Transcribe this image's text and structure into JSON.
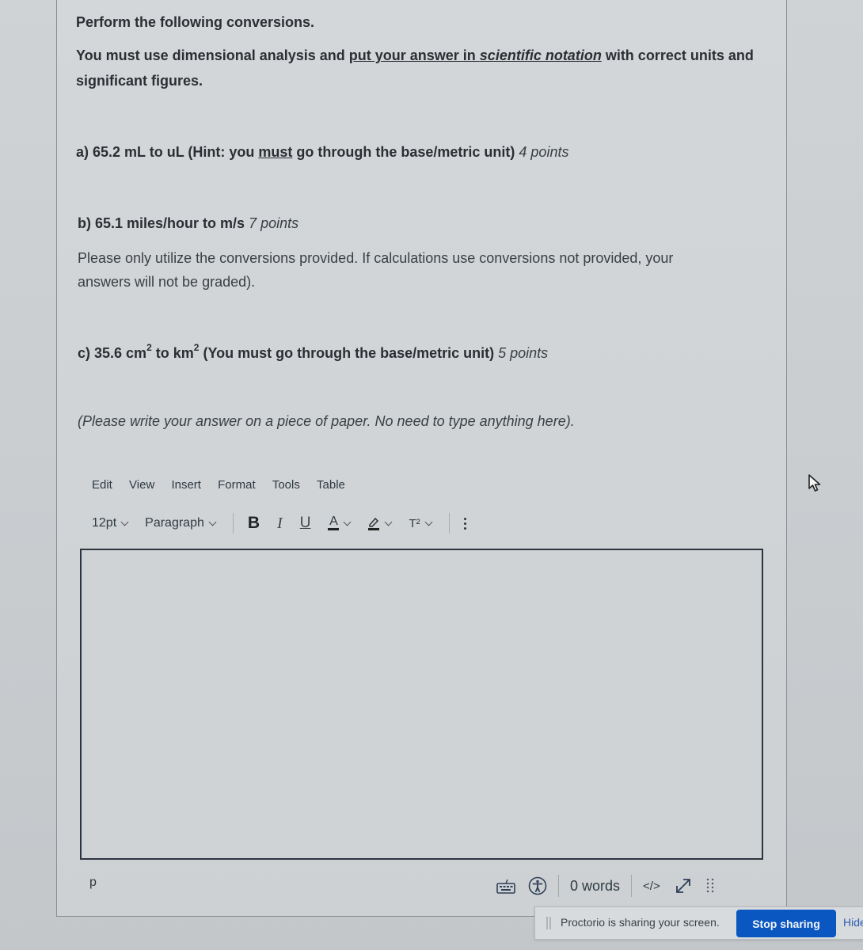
{
  "question": {
    "intro": "Perform the following conversions.",
    "instructions": {
      "part1": "You must use dimensional analysis and ",
      "emphasis_underlined": "put your answer in ",
      "emphasis_italic_underlined": "scientific notation",
      "part2": " with correct units and",
      "line2": "significant figures."
    },
    "a": {
      "prefix": "a) 65.2 mL to uL (Hint: you ",
      "underlined": "must",
      "suffix": " go through the base/metric unit)",
      "points": "4 points"
    },
    "b": {
      "text": "b) 65.1 miles/hour to m/s",
      "points": "7 points",
      "note_line1": "Please only utilize the conversions provided. If calculations use conversions not provided, your",
      "note_line2": "answers will not be graded)."
    },
    "c": {
      "prefix": "c) 35.6 cm",
      "sup1": "2",
      "mid": " to km",
      "sup2": "2",
      "suffix": " (You must go through the base/metric unit)",
      "points": "5 points"
    },
    "paper_note": "(Please write your answer on a piece of paper. No need to type anything here)."
  },
  "editor": {
    "menu": [
      "Edit",
      "View",
      "Insert",
      "Format",
      "Tools",
      "Table"
    ],
    "toolbar": {
      "font_size": "12pt",
      "block_format": "Paragraph",
      "bold": "B",
      "italic": "I",
      "underline": "U",
      "text_color": "A",
      "superscript": "T²"
    },
    "content": "",
    "status": {
      "path": "p",
      "word_count": "0 words",
      "html_toggle": "</>"
    }
  },
  "proctorio": {
    "message": "Proctorio is sharing your screen.",
    "stop_label": "Stop sharing",
    "hide_label": "Hide",
    "accent": "#0b57c2"
  }
}
